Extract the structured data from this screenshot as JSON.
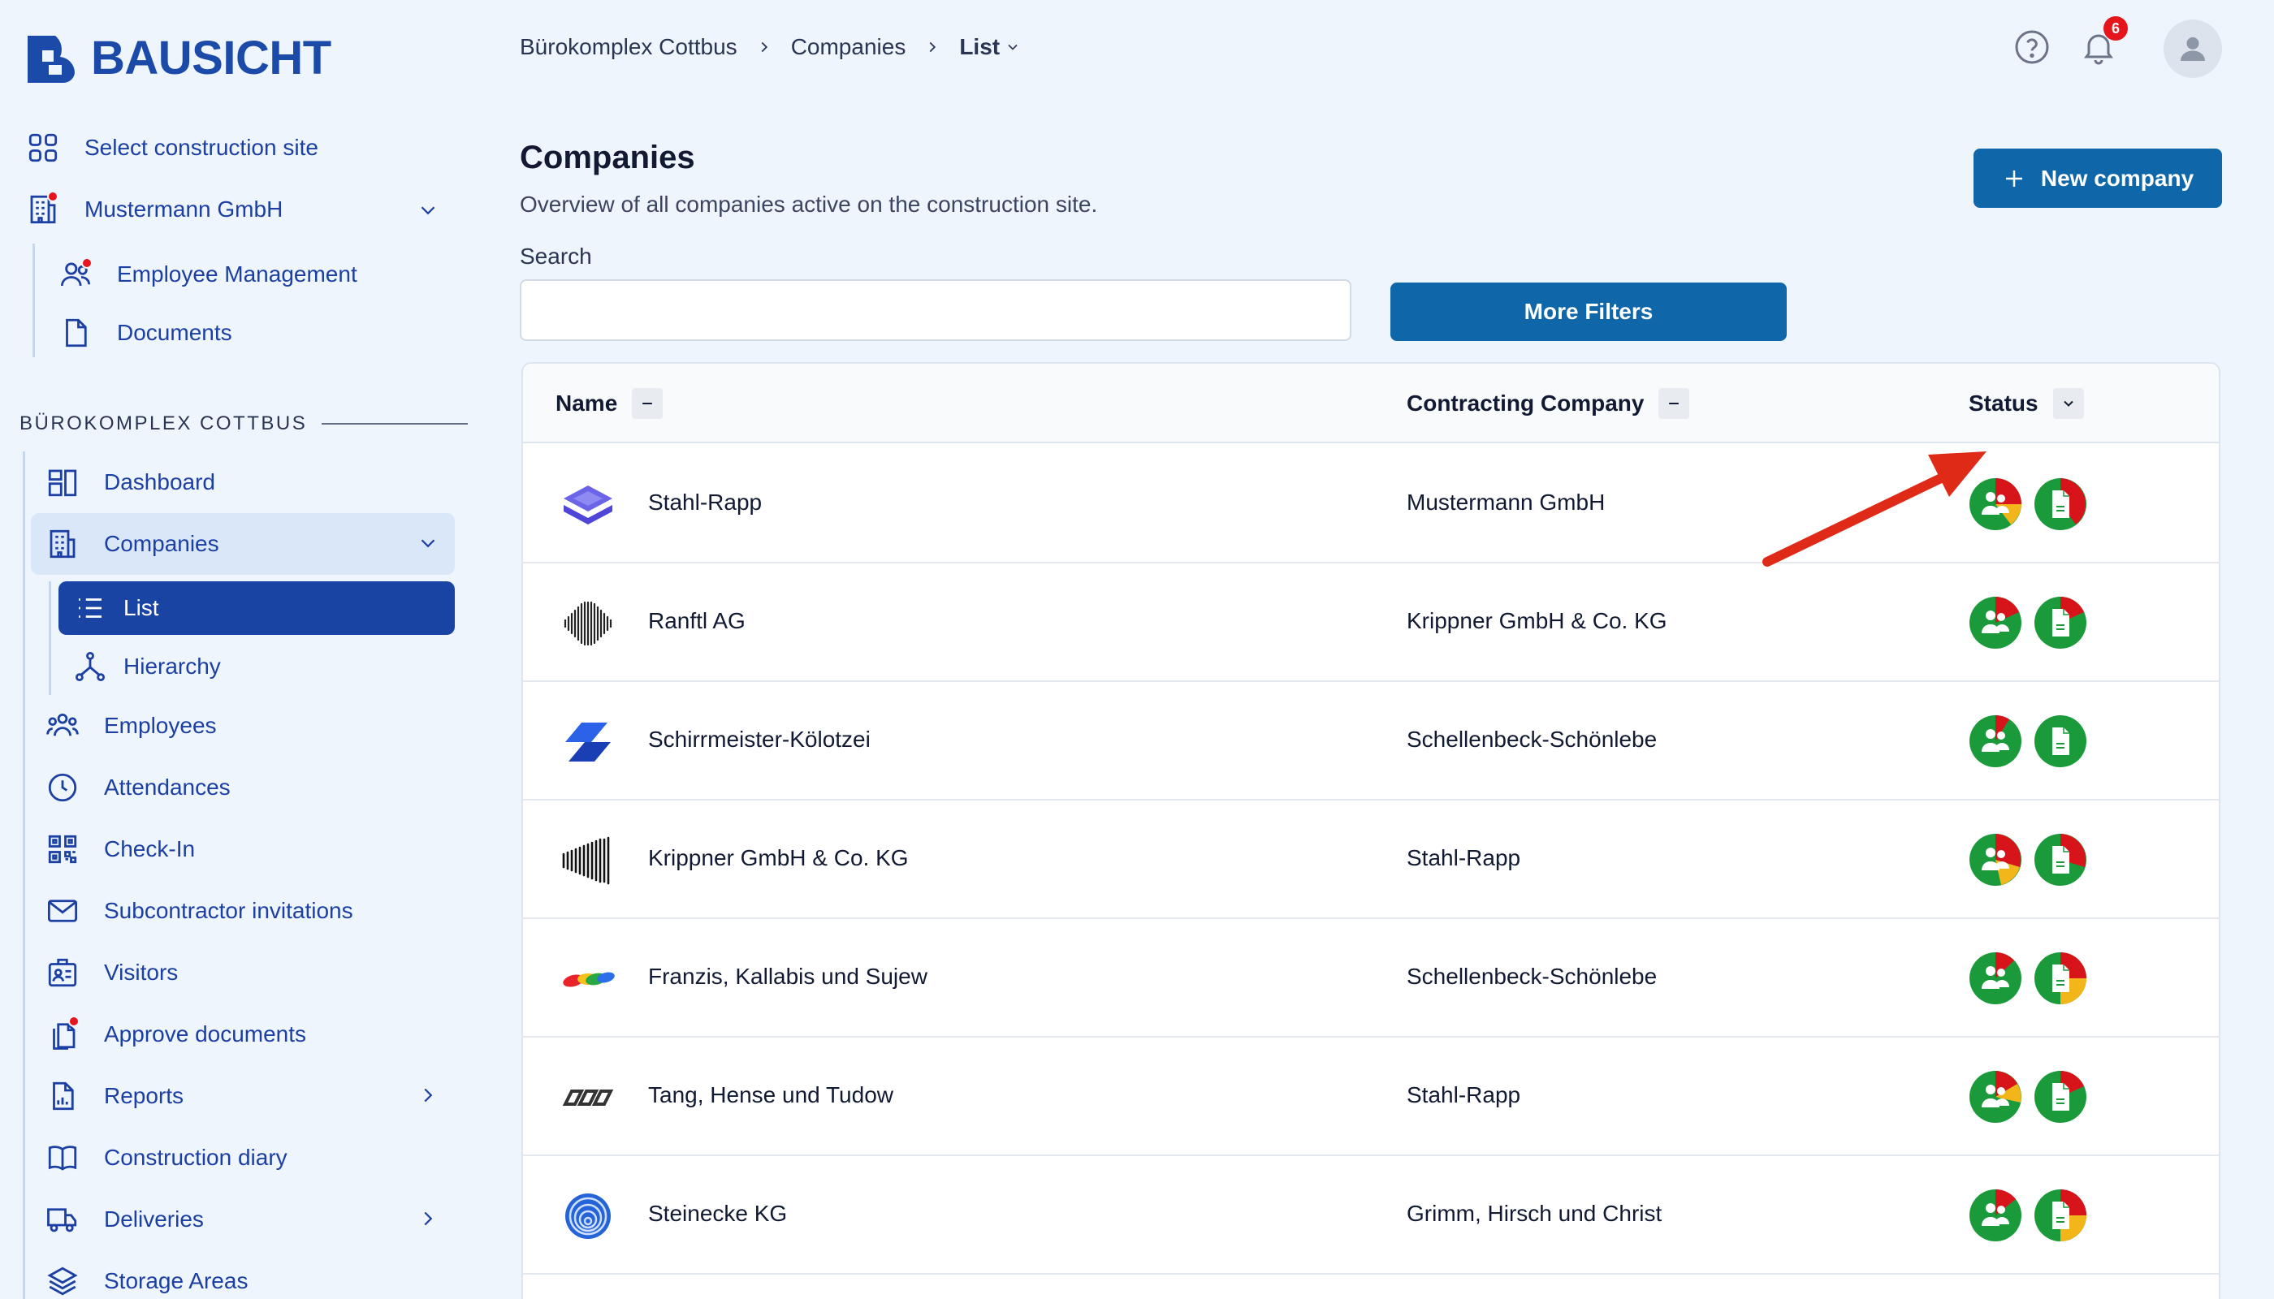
{
  "brand": {
    "name": "BAUSICHT",
    "primary": "#1a44a4",
    "button": "#0f66a8",
    "alert": "#e5151b"
  },
  "sidebar": {
    "select_site": "Select construction site",
    "company": "Mustermann GmbH",
    "company_items": [
      "Employee Management",
      "Documents"
    ],
    "section_title": "BÜROKOMPLEX COTTBUS",
    "items": [
      {
        "label": "Dashboard",
        "icon": "dashboard-icon"
      },
      {
        "label": "Companies",
        "icon": "building-icon"
      },
      {
        "label": "List",
        "icon": "list-icon"
      },
      {
        "label": "Hierarchy",
        "icon": "hierarchy-icon"
      },
      {
        "label": "Employees",
        "icon": "users-icon"
      },
      {
        "label": "Attendances",
        "icon": "clock-icon"
      },
      {
        "label": "Check-In",
        "icon": "qr-icon"
      },
      {
        "label": "Subcontractor invitations",
        "icon": "mail-icon"
      },
      {
        "label": "Visitors",
        "icon": "badge-icon"
      },
      {
        "label": "Approve documents",
        "icon": "docs-icon"
      },
      {
        "label": "Reports",
        "icon": "report-icon"
      },
      {
        "label": "Construction diary",
        "icon": "book-icon"
      },
      {
        "label": "Deliveries",
        "icon": "truck-icon"
      },
      {
        "label": "Storage Areas",
        "icon": "layers-icon"
      }
    ]
  },
  "breadcrumb": [
    "Bürokomplex Cottbus",
    "Companies",
    "List"
  ],
  "notifications": {
    "count": "6"
  },
  "page": {
    "title": "Companies",
    "subtitle": "Overview of all companies active on the construction site.",
    "new_button": "New company",
    "search_label": "Search",
    "search_placeholder": "",
    "filter_button": "More Filters"
  },
  "table": {
    "columns": [
      "Name",
      "Contracting Company",
      "Status"
    ],
    "rows": [
      {
        "name": "Stahl-Rapp",
        "contractor": "Mustermann GmbH"
      },
      {
        "name": "Ranftl AG",
        "contractor": "Krippner GmbH & Co. KG"
      },
      {
        "name": "Schirrmeister-Kölotzei",
        "contractor": "Schellenbeck-Schönlebe"
      },
      {
        "name": "Krippner GmbH & Co. KG",
        "contractor": "Stahl-Rapp"
      },
      {
        "name": "Franzis, Kallabis und Sujew",
        "contractor": "Schellenbeck-Schönlebe"
      },
      {
        "name": "Tang, Hense und Tudow",
        "contractor": "Stahl-Rapp"
      },
      {
        "name": "Steinecke KG",
        "contractor": "Grimm, Hirsch und Christ"
      }
    ]
  }
}
